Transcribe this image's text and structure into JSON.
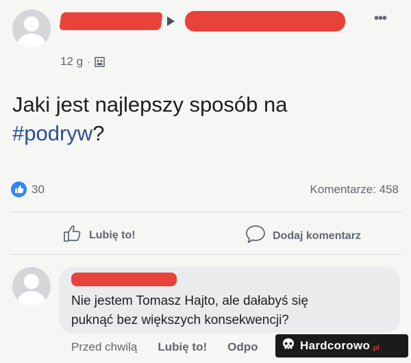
{
  "post": {
    "time": "12 g",
    "separator": "·",
    "text_main": "Jaki jest najlepszy sposób na",
    "hashtag": "#podryw",
    "text_end": "?",
    "more_label": "•••"
  },
  "reactions": {
    "like_count": "30",
    "comments_label": "Komentarze: 458"
  },
  "actions": {
    "like_label": "Lubię to!",
    "comment_label": "Dodaj komentarz"
  },
  "comment": {
    "text_line1": "Nie jestem Tomasz Hajto, ale dałabyś się",
    "text_line2": "puknąć bez większych konsekwencji?",
    "time": "Przed chwilą",
    "like_label": "Lubię to!",
    "reply_label": "Odpo"
  },
  "watermark": {
    "text": "Hardcorowo",
    "suffix": ".pl"
  },
  "colors": {
    "redaction": "#e8423a",
    "hashtag": "#2b4f8f",
    "like_blue": "#2d86ff"
  }
}
